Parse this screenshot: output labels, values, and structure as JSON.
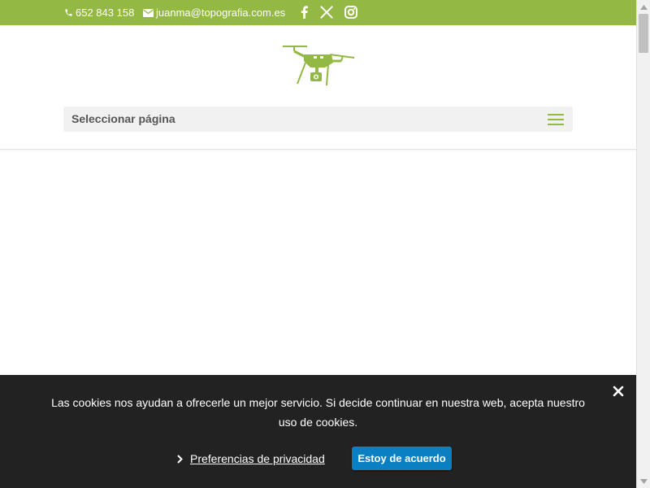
{
  "topbar": {
    "phone": "652 843 158",
    "email": "juanma@topografia.com.es",
    "social_icons": [
      "facebook-icon",
      "x-icon",
      "instagram-icon"
    ],
    "background_color": "#93b843"
  },
  "header": {
    "logo_icon": "drone-logo-icon",
    "menu_label": "Seleccionar página",
    "accent_color": "#93b843"
  },
  "cookie_banner": {
    "message": "Las cookies nos ayudan a ofrecerle un mejor servicio. Si decide continuar en nuestra web, acepta nuestro uso de cookies.",
    "privacy_link": "Preferencias de privacidad",
    "accept_label": "Estoy de acuerdo",
    "background_color": "#222222",
    "button_color": "#0a7fc2"
  }
}
